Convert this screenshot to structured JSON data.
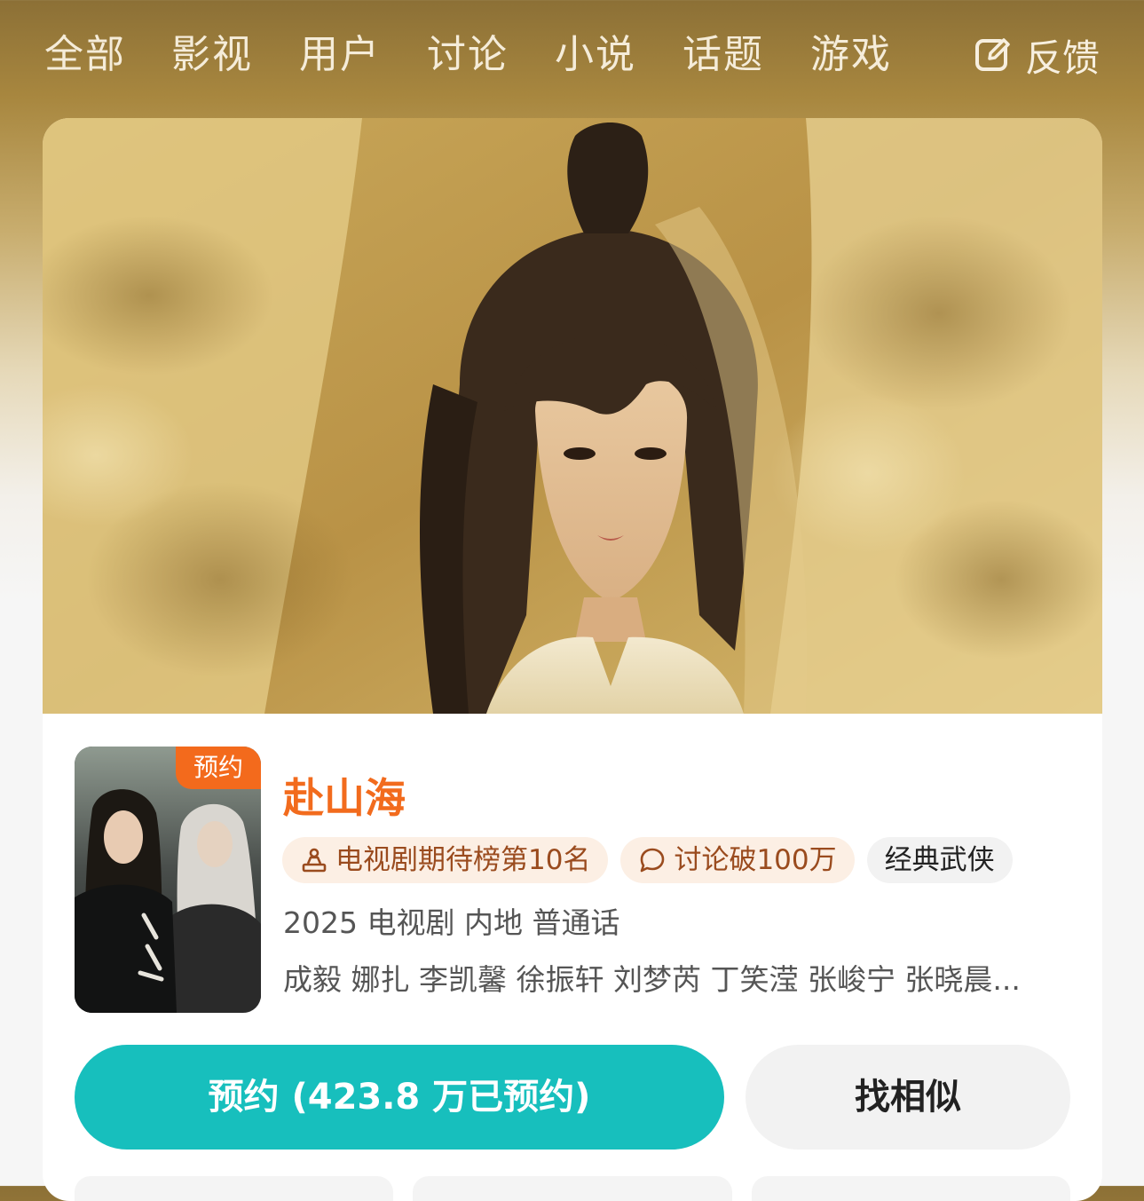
{
  "tabs": [
    "全部",
    "影视",
    "用户",
    "讨论",
    "小说",
    "话题",
    "游戏"
  ],
  "feedback": {
    "label": "反馈",
    "icon": "edit-icon"
  },
  "card": {
    "poster_badge": "预约",
    "title": "赴山海",
    "tags": [
      {
        "icon": "ranking-icon",
        "text": "电视剧期待榜第10名"
      },
      {
        "icon": "comment-icon",
        "text": "讨论破100万"
      },
      {
        "text": "经典武侠"
      }
    ],
    "meta": "2025 电视剧 内地 普通话",
    "cast": "成毅 娜扎 李凯馨 徐振轩 刘梦芮 丁笑滢 张峻宁 张晓晨...",
    "reserve_button": "预约 (423.8 万已预约)",
    "similar_button": "找相似"
  },
  "colors": {
    "accent_orange": "#f26b1d",
    "reserve_teal": "#17bfbd",
    "header_gold": "#8c7036"
  }
}
